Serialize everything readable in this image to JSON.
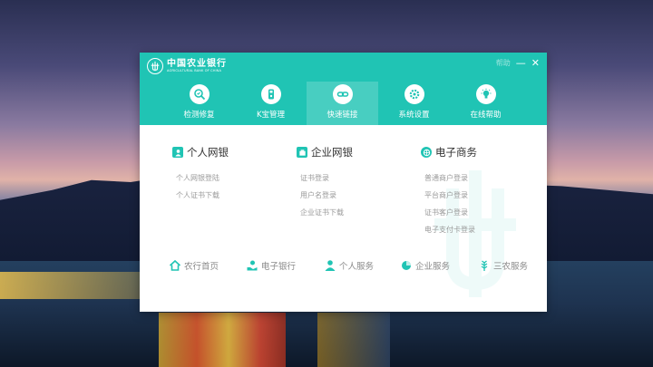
{
  "window": {
    "logo_cn": "中国农业银行",
    "logo_en": "AGRICULTURAL BANK OF CHINA",
    "help_label": "帮助",
    "minimize_label": "—",
    "close_label": "✕"
  },
  "toolbar": [
    {
      "label": "检测修复",
      "icon": "search-repair-icon",
      "active": false
    },
    {
      "label": "K宝管理",
      "icon": "k-bao-key-icon",
      "active": false
    },
    {
      "label": "快速链接",
      "icon": "link-icon",
      "active": true
    },
    {
      "label": "系统设置",
      "icon": "gear-icon",
      "active": false
    },
    {
      "label": "在线帮助",
      "icon": "lightbulb-icon",
      "active": false
    }
  ],
  "columns": [
    {
      "title": "个人网银",
      "icon": "person-icon",
      "links": [
        "个人网银登陆",
        "个人证书下载"
      ]
    },
    {
      "title": "企业网银",
      "icon": "building-icon",
      "links": [
        "证书登录",
        "用户名登录",
        "企业证书下载"
      ]
    },
    {
      "title": "电子商务",
      "icon": "ecommerce-icon",
      "links": [
        "普通商户登录",
        "平台商户登录",
        "证书客户登录",
        "电子支付卡登录"
      ]
    }
  ],
  "bottom_links": [
    {
      "label": "农行首页",
      "icon": "home-icon"
    },
    {
      "label": "电子银行",
      "icon": "hand-coin-icon"
    },
    {
      "label": "个人服务",
      "icon": "person-icon"
    },
    {
      "label": "企业服务",
      "icon": "pie-icon"
    },
    {
      "label": "三农服务",
      "icon": "wheat-icon"
    }
  ],
  "colors": {
    "accent": "#20c4b4",
    "link_gray": "#9a9a9a"
  }
}
